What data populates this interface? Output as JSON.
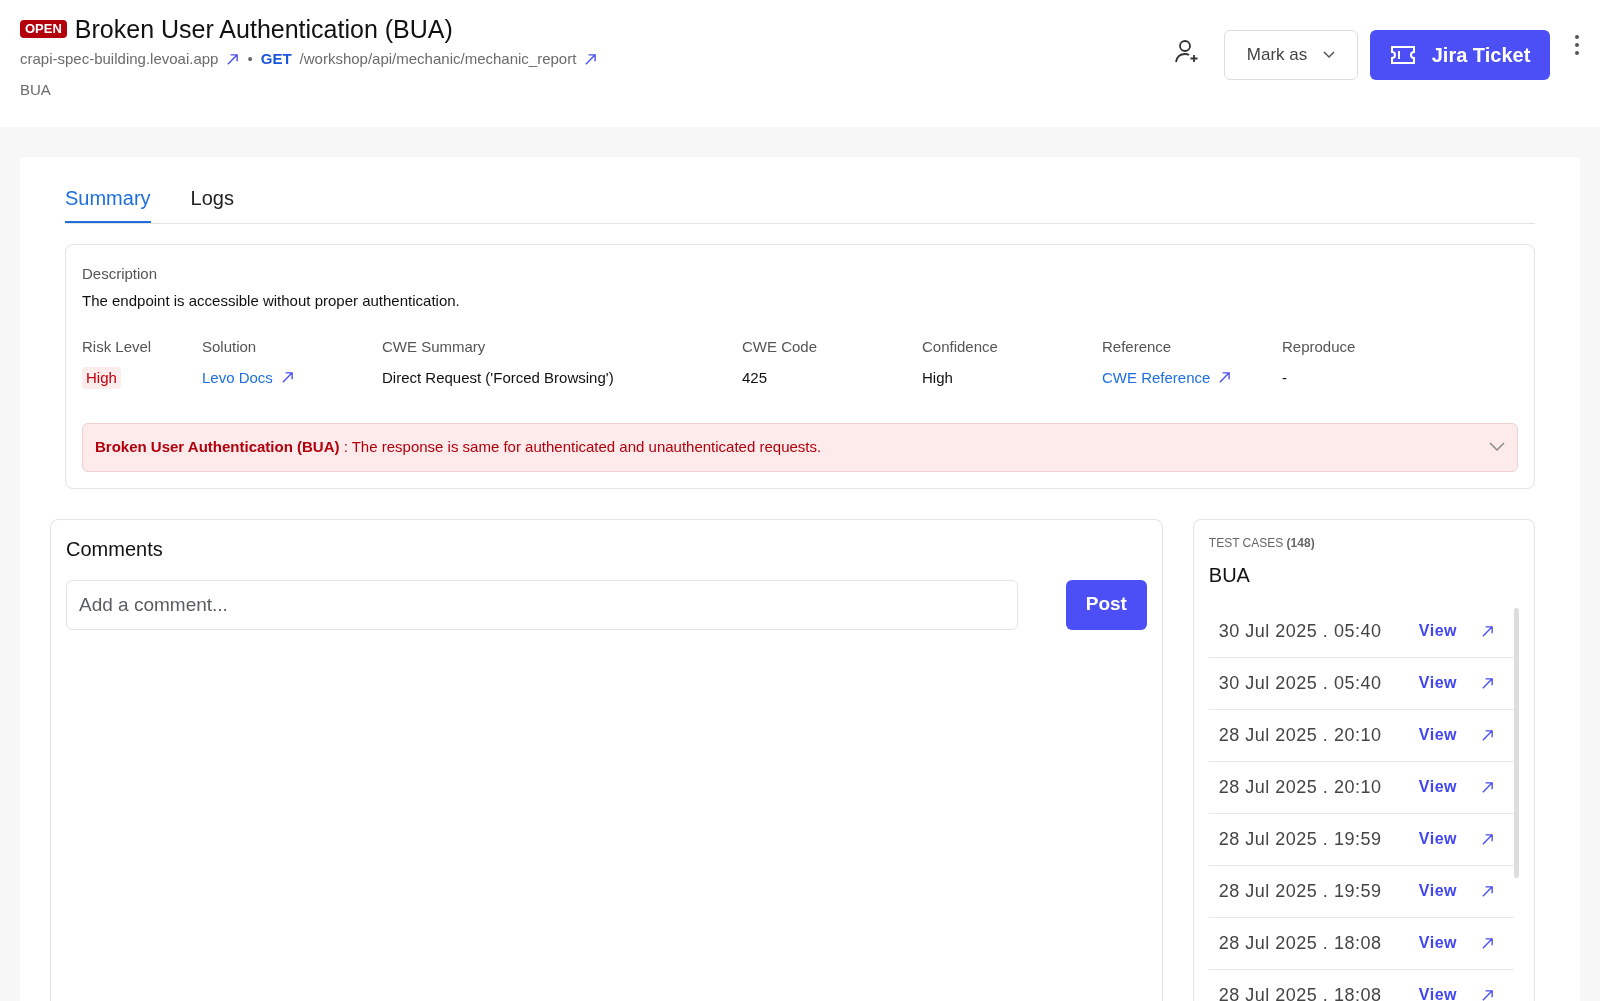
{
  "header": {
    "status_badge": "OPEN",
    "title": "Broken User Authentication (BUA)",
    "host": "crapi-spec-building.levoai.app",
    "separator": "•",
    "method": "GET",
    "path": "/workshop/api/mechanic/mechanic_report",
    "category": "BUA",
    "mark_as": "Mark as",
    "jira_button": "Jira Ticket"
  },
  "tabs": [
    {
      "label": "Summary",
      "selected": true
    },
    {
      "label": "Logs",
      "selected": false
    }
  ],
  "description": {
    "label": "Description",
    "text": "The endpoint is accessible without proper authentication."
  },
  "fields": [
    {
      "label": "Risk Level",
      "value": "High",
      "kind": "risk"
    },
    {
      "label": "Solution",
      "value": "Levo Docs",
      "kind": "link"
    },
    {
      "label": "CWE Summary",
      "value": "Direct Request ('Forced Browsing')",
      "kind": "text"
    },
    {
      "label": "CWE Code",
      "value": "425",
      "kind": "text"
    },
    {
      "label": "Confidence",
      "value": "High",
      "kind": "text"
    },
    {
      "label": "Reference",
      "value": "CWE Reference",
      "kind": "link"
    },
    {
      "label": "Reproduce",
      "value": "-",
      "kind": "text"
    }
  ],
  "alert": {
    "title": "Broken User Authentication (BUA)",
    "message": ": The response is same for authenticated and unauthenticated requests.",
    "expanded": false
  },
  "comments": {
    "title": "Comments",
    "placeholder": "Add a comment...",
    "post_button": "Post"
  },
  "test_cases": {
    "heading": "TEST CASES **(148)**",
    "name": "BUA",
    "rows": [
      {
        "time": "30 Jul 2025 . 05:40",
        "link": "View"
      },
      {
        "time": "30 Jul 2025 . 05:40",
        "link": "View"
      },
      {
        "time": "28 Jul 2025 . 20:10",
        "link": "View"
      },
      {
        "time": "28 Jul 2025 . 20:10",
        "link": "View"
      },
      {
        "time": "28 Jul 2025 . 19:59",
        "link": "View"
      },
      {
        "time": "28 Jul 2025 . 19:59",
        "link": "View"
      },
      {
        "time": "28 Jul 2025 . 18:08",
        "link": "View"
      },
      {
        "time": "28 Jul 2025 . 18:08",
        "link": "View"
      }
    ]
  }
}
